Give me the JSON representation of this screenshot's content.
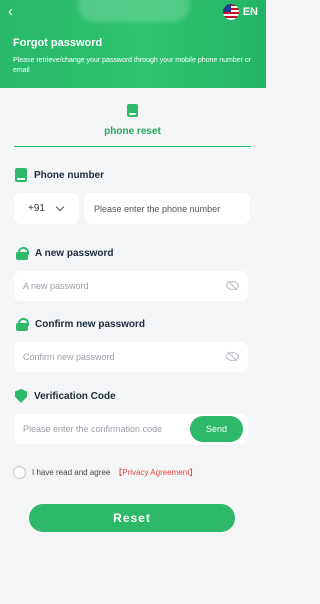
{
  "header": {
    "back_icon": "chevron-left-icon",
    "language": {
      "flag_icon": "us-flag-icon",
      "label": "EN"
    },
    "title": "Forgot password",
    "subtitle": "Please retrieve/change your password through your mobile phone number or email"
  },
  "tab": {
    "icon": "phone-icon",
    "label": "phone reset"
  },
  "phone": {
    "label": "Phone number",
    "country_code": "+91",
    "placeholder": "Please enter the phone number",
    "value": ""
  },
  "new_password": {
    "label": "A new password",
    "placeholder": "A new password",
    "value": "",
    "visibility_icon": "eye-off-icon"
  },
  "confirm_password": {
    "label": "Confirm new password",
    "placeholder": "Confirm new password",
    "value": "",
    "visibility_icon": "eye-off-icon"
  },
  "verification": {
    "label": "Verification Code",
    "placeholder": "Please enter the confirmation code",
    "value": "",
    "send_label": "Send"
  },
  "agreement": {
    "text": "I have read and agree",
    "link": "【Privacy Agreement】",
    "checked": false
  },
  "reset_button": "Reset",
  "colors": {
    "accent": "#2eb86a",
    "link": "#e4473f",
    "background": "#f4f5f7"
  }
}
